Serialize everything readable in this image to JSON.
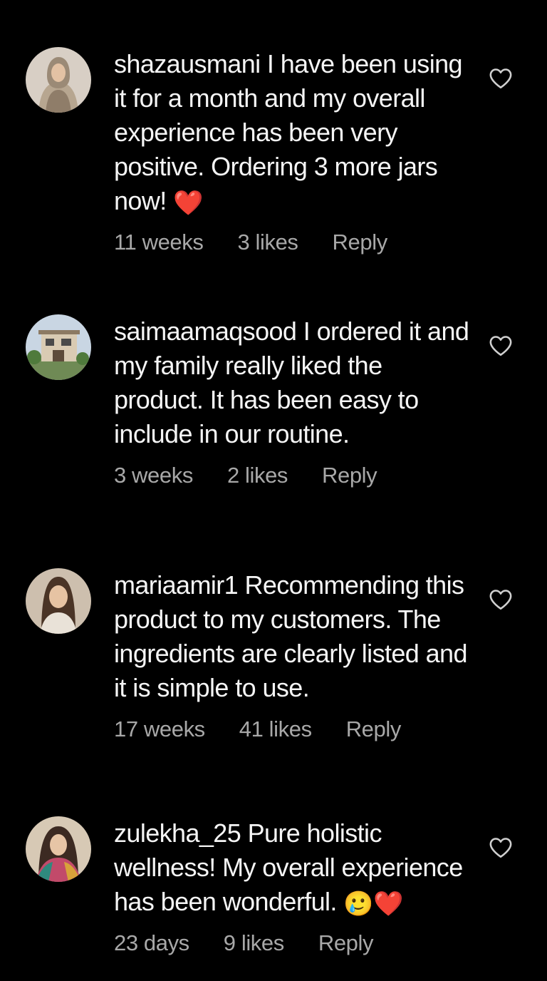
{
  "comments": [
    {
      "username": "shazausmani",
      "text": "I have been using it for a month and my overall experience has been very positive. Ordering 3 more jars now!",
      "emoji": "❤️",
      "time": "11 weeks",
      "likes": "3 likes",
      "reply": "Reply",
      "avatar": "woman-with-shawl-avatar"
    },
    {
      "username": "saimaamaqsood",
      "text": "I ordered it and my family really liked the product. It has been easy to include in our routine.",
      "emoji": "",
      "time": "3 weeks",
      "likes": "2 likes",
      "reply": "Reply",
      "avatar": "house-avatar"
    },
    {
      "username": "mariaamir1",
      "text": "Recommending this product to my customers. The ingredients are clearly listed and it is simple to use.",
      "emoji": "",
      "time": "17 weeks",
      "likes": "41 likes",
      "reply": "Reply",
      "avatar": "woman-portrait-avatar"
    },
    {
      "username": "zulekha_25",
      "text": "Pure holistic wellness! My overall experience has been wonderful.",
      "emoji": "🥲❤️",
      "time": "23 days",
      "likes": "9 likes",
      "reply": "Reply",
      "avatar": "woman-colorful-dupatta-avatar"
    }
  ],
  "colors": {
    "background": "#000000",
    "text": "#f5f5f5",
    "meta": "#a8a8a8",
    "heart_outline": "#cfcfcf",
    "heart_emoji": "#e8202e"
  }
}
